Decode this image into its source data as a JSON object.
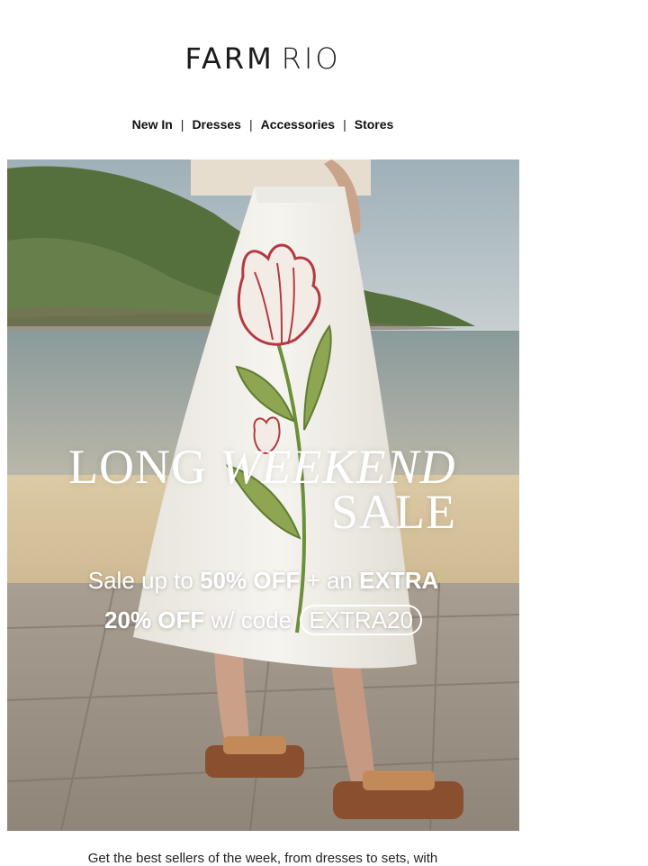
{
  "brand": {
    "name_part1": "FARM",
    "name_part2": "RIO"
  },
  "nav": [
    "New In",
    "Dresses",
    "Accessories",
    "Stores"
  ],
  "hero": {
    "headline_word1": "LONG",
    "headline_word2": "WEEKEND",
    "headline_line2": "SALE",
    "offer_line1_prefix": "Sale up to",
    "offer_line1_bold": "50% OFF",
    "offer_line1_mid": "+ an",
    "offer_line1_extra": "EXTRA",
    "offer_line2_bold": "20% OFF",
    "offer_line2_mid": "w/ code",
    "promo_code": "EXTRA20"
  },
  "footer": {
    "intro_text": "Get the best sellers of the week, from dresses to sets, with"
  },
  "colors": {
    "sand": "#d9c6a3",
    "sea": "#8c9c9c",
    "skirt": "#f3f1ec",
    "tulip_red": "#b43a42",
    "leaf_green": "#8ea552"
  }
}
